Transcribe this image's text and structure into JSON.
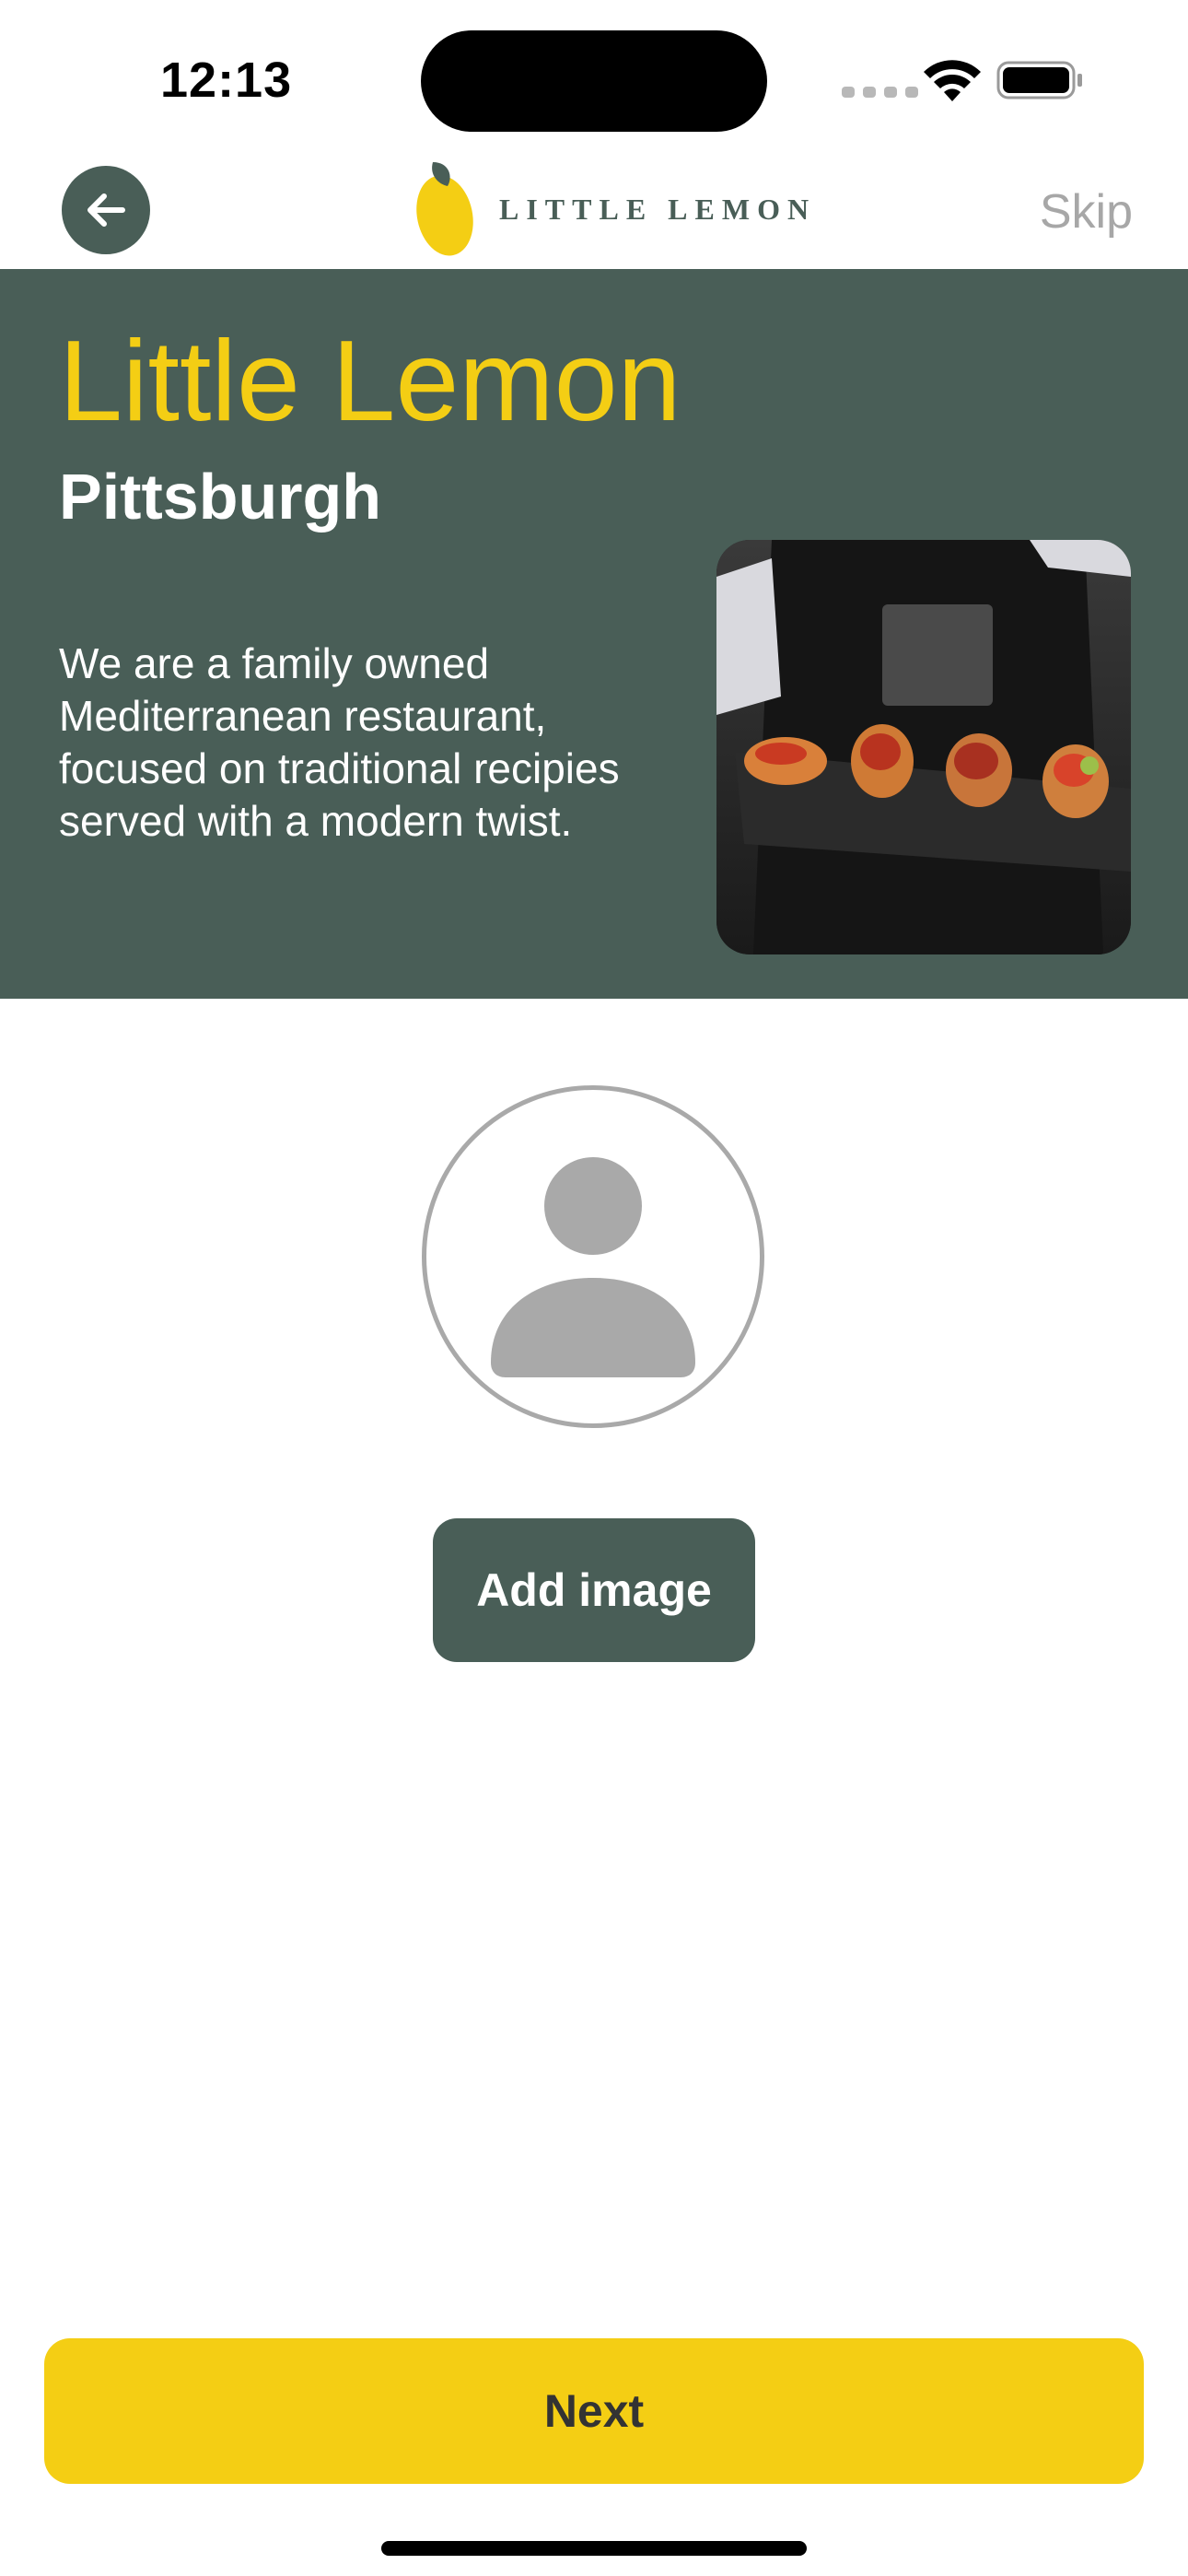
{
  "status_bar": {
    "time": "12:13"
  },
  "nav": {
    "back_icon": "arrow-left-icon",
    "logo_text": "LITTLE LEMON",
    "skip_label": "Skip"
  },
  "hero": {
    "title": "Little Lemon",
    "subtitle": "Pittsburgh",
    "description": "We are a family owned Mediterranean restaurant, focused on traditional recipies served with a modern twist."
  },
  "profile": {
    "avatar_icon": "person-icon",
    "add_image_label": "Add image"
  },
  "footer": {
    "next_label": "Next"
  },
  "colors": {
    "primary_green": "#495e57",
    "primary_yellow": "#f4ce14",
    "muted_gray": "#a7a7a7"
  }
}
